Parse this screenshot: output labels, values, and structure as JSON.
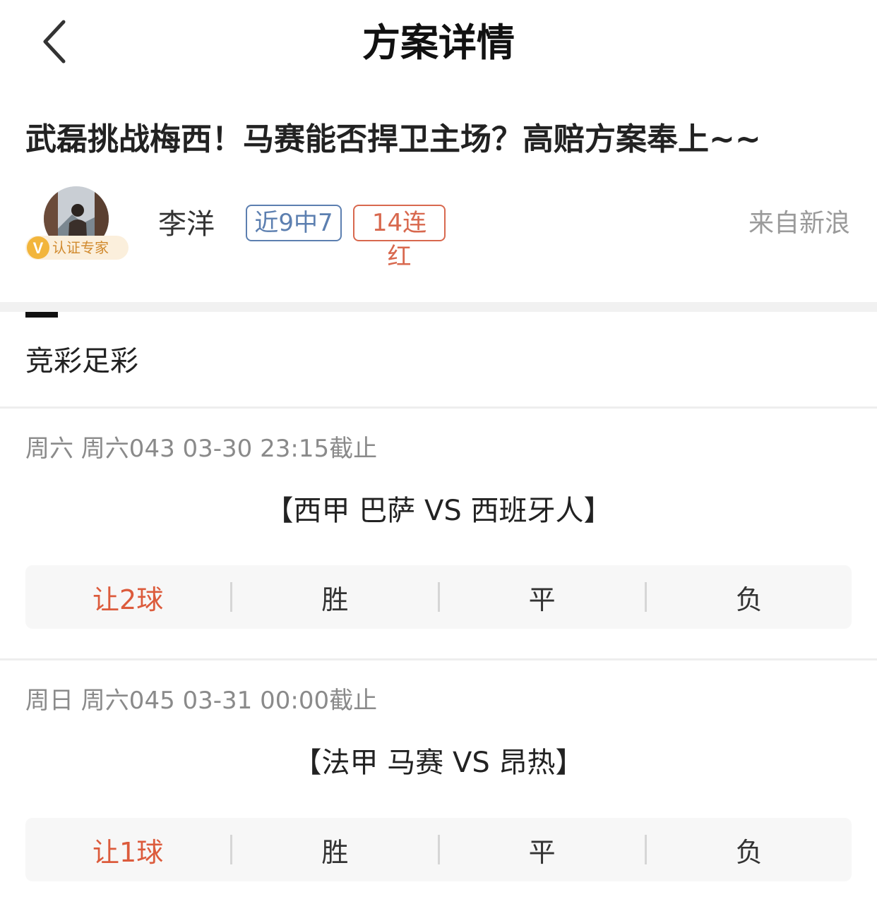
{
  "nav": {
    "title": "方案详情"
  },
  "article": {
    "title": "武磊挑战梅西！马赛能否捍卫主场？高赔方案奉上~~"
  },
  "author": {
    "name": "李洋",
    "verify_badge": "认证专家",
    "verify_letter": "V",
    "tags": [
      "近9中7",
      "14连红"
    ],
    "source": "来自新浪"
  },
  "tab": {
    "label": "竞彩足彩"
  },
  "matches": [
    {
      "meta": "周六 周六043 03-30 23:15截止",
      "title": "【西甲 巴萨 VS 西班牙人】",
      "odds": [
        "让2球",
        "胜",
        "平",
        "负"
      ]
    },
    {
      "meta": "周日 周六045 03-31 00:00截止",
      "title": "【法甲 马赛 VS 昂热】",
      "odds": [
        "让1球",
        "胜",
        "平",
        "负"
      ]
    }
  ],
  "colors": {
    "accent_red": "#dc5b3c",
    "tag_blue": "#5c7fb0",
    "tag_red": "#d8684e",
    "badge_gold": "#f2b53b"
  }
}
